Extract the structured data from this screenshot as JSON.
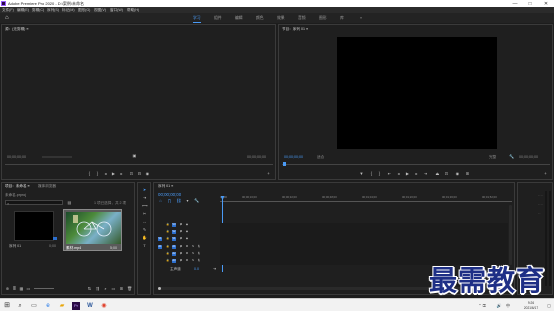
{
  "window": {
    "title": "Adobe Premiere Pro 2020 - D:\\案例\\未命名",
    "minimize": "—",
    "maximize": "□",
    "close": "✕"
  },
  "menu": [
    "文件(F)",
    "编辑(E)",
    "剪辑(C)",
    "序列(S)",
    "标记(M)",
    "图形(G)",
    "视图(V)",
    "窗口(W)",
    "帮助(H)"
  ],
  "workspaces": [
    {
      "label": "学习",
      "active": true
    },
    {
      "label": "组件",
      "active": false
    },
    {
      "label": "编辑",
      "active": false
    },
    {
      "label": "颜色",
      "active": false
    },
    {
      "label": "效果",
      "active": false
    },
    {
      "label": "音频",
      "active": false
    },
    {
      "label": "图形",
      "active": false
    },
    {
      "label": "库",
      "active": false
    },
    {
      "label": "»",
      "active": false
    }
  ],
  "source": {
    "title": "源：(无剪辑) ≡",
    "timecode_left": "00;00;00;00",
    "timecode_right": "00;00;00;00"
  },
  "program": {
    "title": "节目：序列 01 ≡",
    "timecode": "00;00;00;00",
    "fit": "适合",
    "quality": "完整",
    "duration": "00;00;00;00"
  },
  "project": {
    "tab_project": "项目：未命名 ≡",
    "tab_media": "媒体浏览器",
    "file": "未命名.prproj",
    "search_placeholder": "",
    "selection_info": "1 项已选择，共 2 项",
    "items": [
      {
        "name": "序列 01",
        "duration": "0;00"
      },
      {
        "name": "素材.mp4",
        "duration": "5;00"
      }
    ]
  },
  "timeline": {
    "title": "序列 01 ≡",
    "timecode": "00;00;00;00",
    "ruler": [
      "00;00",
      "00;00;16;00",
      "00;00;32;00",
      "00;00;48;00",
      "00;01;04;00",
      "00;01;20;00",
      "00;01;36;00",
      "00;01;52;00"
    ],
    "video_tracks": [
      "V3",
      "V2",
      "V1"
    ],
    "audio_tracks": [
      "A1",
      "A2",
      "A3"
    ],
    "master": "主声道",
    "master_value": "0.0"
  },
  "taskbar": {
    "time": "9:26",
    "date": "2021/6/17"
  },
  "watermark": "最需教育"
}
